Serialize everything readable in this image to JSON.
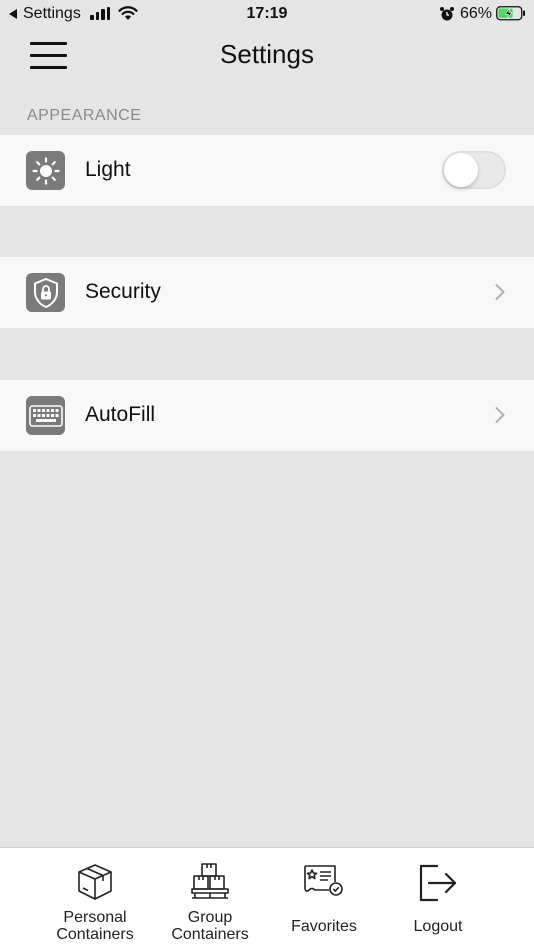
{
  "status_bar": {
    "back_app": "Settings",
    "time": "17:19",
    "battery_percent": "66%",
    "battery_level": 0.66,
    "icons": [
      "back-triangle-icon",
      "signal-icon",
      "wifi-icon",
      "alarm-icon",
      "battery-charging-icon"
    ]
  },
  "nav": {
    "title": "Settings",
    "menu_icon": "hamburger-menu-icon"
  },
  "sections": {
    "appearance": {
      "header": "APPEARANCE",
      "row": {
        "label": "Light",
        "icon": "sun-icon",
        "toggle_on": false
      }
    },
    "security": {
      "label": "Security",
      "icon": "shield-lock-icon",
      "accessory": "chevron-right-icon"
    },
    "autofill": {
      "label": "AutoFill",
      "icon": "keyboard-icon",
      "accessory": "chevron-right-icon"
    }
  },
  "tab_bar": {
    "tabs": [
      {
        "label_line1": "Personal",
        "label_line2": "Containers",
        "icon": "package-box-icon"
      },
      {
        "label_line1": "Group",
        "label_line2": "Containers",
        "icon": "stacked-boxes-icon"
      },
      {
        "label": "Favorites",
        "icon": "favorite-document-icon"
      },
      {
        "label": "Logout",
        "icon": "logout-icon"
      }
    ]
  },
  "colors": {
    "background": "#e5e5e5",
    "row_background": "#f8f8f8",
    "icon_tile": "#7a7a7a",
    "section_header": "#8a8a8a",
    "battery_green": "#4cd964"
  }
}
